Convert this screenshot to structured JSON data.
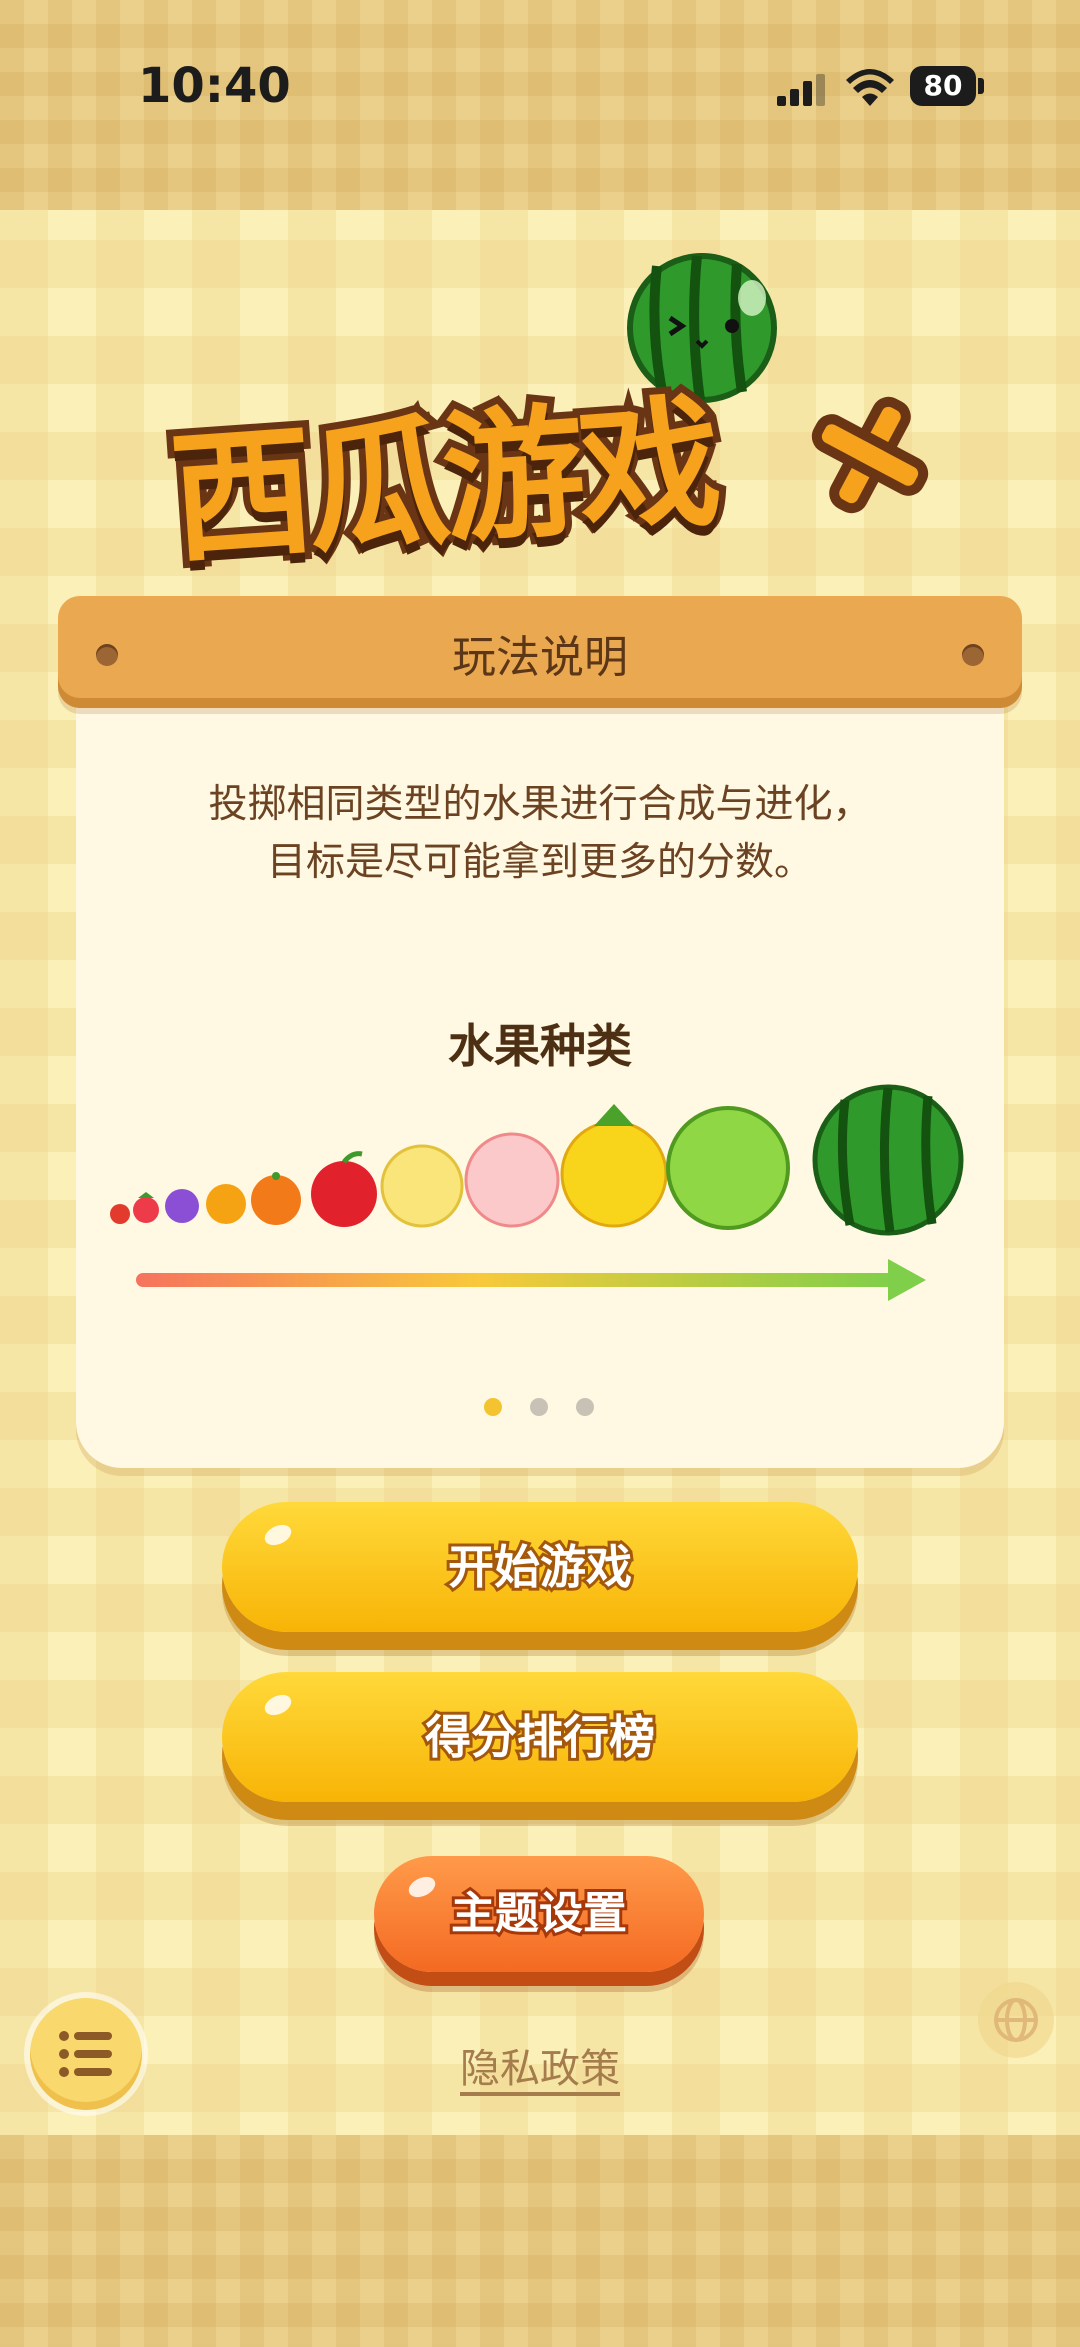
{
  "status_bar": {
    "time": "10:40",
    "battery": "80"
  },
  "logo": {
    "text": "西瓜游戏"
  },
  "card": {
    "title": "玩法说明",
    "description_line1": "投掷相同类型的水果进行合成与进化，",
    "description_line2": "目标是尽可能拿到更多的分数。",
    "section_title": "水果种类",
    "fruits": [
      "cherry-icon",
      "strawberry-icon",
      "grape-icon",
      "kumquat-icon",
      "orange-icon",
      "apple-icon",
      "pear-icon",
      "peach-icon",
      "pineapple-icon",
      "melon-icon",
      "watermelon-icon"
    ],
    "pagination": {
      "total": 3,
      "active": 1
    }
  },
  "buttons": {
    "start": "开始游戏",
    "leaderboard": "得分排行榜",
    "theme": "主题设置"
  },
  "footer": {
    "privacy": "隐私政策"
  },
  "colors": {
    "accent_yellow": "#f8b406",
    "accent_orange": "#f46a22",
    "card_bg": "#fff8e2",
    "header_wood": "#eaa851"
  }
}
